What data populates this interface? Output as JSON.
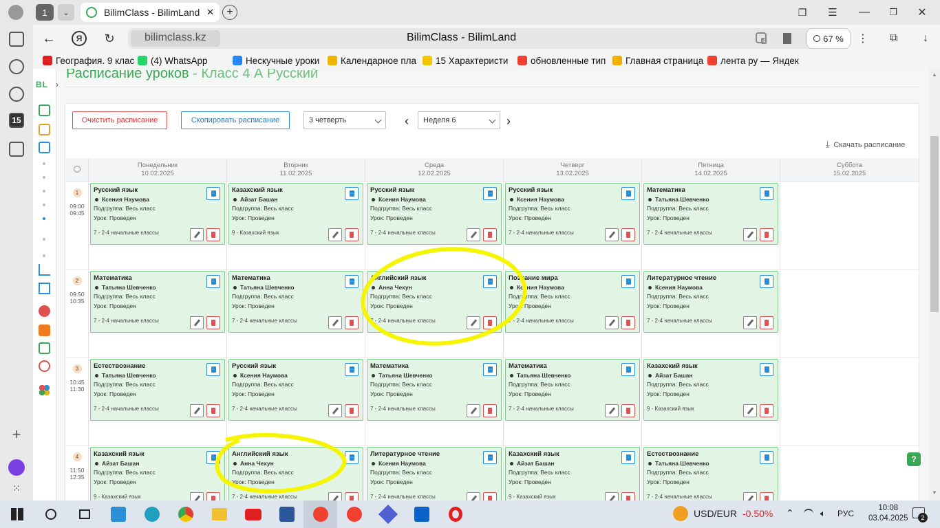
{
  "browser": {
    "tab_count": "1",
    "tab_title": "BilimClass - BilimLand",
    "url": "bilimclass.kz",
    "page_title": "BilimClass - BilimLand",
    "zoom": "67 %",
    "tracker_count": "4"
  },
  "bookmarks": [
    {
      "label": "География. 9 клас",
      "icon": "youtube-icon",
      "color": "#e02020"
    },
    {
      "label": "(4) WhatsApp",
      "icon": "whatsapp-icon",
      "color": "#25d366"
    },
    {
      "label": "Нескучные уроки",
      "icon": "vk-icon",
      "color": "#2787f5"
    },
    {
      "label": "Календарное пла",
      "icon": "doc-icon",
      "color": "#f0b400"
    },
    {
      "label": "15 Характеристи",
      "icon": "play-icon",
      "color": "#f5c400"
    },
    {
      "label": "обновленные тип",
      "icon": "yandex-icon",
      "color": "#f04030"
    },
    {
      "label": "Главная страница",
      "icon": "person-icon",
      "color": "#f0b000"
    },
    {
      "label": "лента ру — Яндек",
      "icon": "yandex-icon",
      "color": "#f04030"
    }
  ],
  "left_rail": {
    "calendar_day": "15"
  },
  "app": {
    "logo": "BL",
    "heading_main": "Расписание уроков",
    "heading_sep": " - ",
    "heading_class": "Класс 4 А Русский",
    "clear_button": "Очистить расписание",
    "copy_button": "Скопировать расписание",
    "quarter_select": "3 четверть",
    "week_select": "Неделя 6",
    "download_link": "Скачать расписание"
  },
  "days": [
    {
      "name": "Понедельник",
      "date": "10.02.2025"
    },
    {
      "name": "Вторник",
      "date": "11.02.2025"
    },
    {
      "name": "Среда",
      "date": "12.02.2025"
    },
    {
      "name": "Четверг",
      "date": "13.02.2025"
    },
    {
      "name": "Пятница",
      "date": "14.02.2025"
    },
    {
      "name": "Суббота",
      "date": "15.02.2025"
    }
  ],
  "periods": [
    {
      "num": "1",
      "start": "09:00",
      "end": "09:45"
    },
    {
      "num": "2",
      "start": "09:50",
      "end": "10:35"
    },
    {
      "num": "3",
      "start": "10:45",
      "end": "11:30"
    },
    {
      "num": "4",
      "start": "11:50",
      "end": "12:35"
    }
  ],
  "labels": {
    "subgroup": "Подгруппа:",
    "subgroup_val": "Весь класс",
    "lesson": "Урок:",
    "lesson_val": "Проведен"
  },
  "lessons": [
    [
      {
        "subject": "Русский язык",
        "teacher": "Ксения Наумова",
        "group": "7 - 2-4 начальные классы"
      },
      {
        "subject": "Математика",
        "teacher": "Татьяна Шевченко",
        "group": "7 - 2-4 начальные классы"
      },
      {
        "subject": "Естествознание",
        "teacher": "Татьяна Шевченко",
        "group": "7 - 2-4 начальные классы"
      },
      {
        "subject": "Казахский язык",
        "teacher": "Айзат Башан",
        "group": "9 - Казахский язык"
      }
    ],
    [
      {
        "subject": "Казахский язык",
        "teacher": "Айзат Башан",
        "group": "9 - Казахский язык"
      },
      {
        "subject": "Математика",
        "teacher": "Татьяна Шевченко",
        "group": "7 - 2-4 начальные классы"
      },
      {
        "subject": "Русский язык",
        "teacher": "Ксения Наумова",
        "group": "7 - 2-4 начальные классы"
      },
      {
        "subject": "Английский язык",
        "teacher": "Анна Чехун",
        "group": "7 - 2-4 начальные классы"
      }
    ],
    [
      {
        "subject": "Русский язык",
        "teacher": "Ксения Наумова",
        "group": "7 - 2-4 начальные классы"
      },
      {
        "subject": "Английский язык",
        "teacher": "Анна Чехун",
        "group": "7 - 2-4 начальные классы"
      },
      {
        "subject": "Математика",
        "teacher": "Татьяна Шевченко",
        "group": "7 - 2-4 начальные классы"
      },
      {
        "subject": "Литературное чтение",
        "teacher": "Ксения Наумова",
        "group": "7 - 2-4 начальные классы"
      }
    ],
    [
      {
        "subject": "Русский язык",
        "teacher": "Ксения Наумова",
        "group": "7 - 2-4 начальные классы"
      },
      {
        "subject": "Познание мира",
        "teacher": "Ксения Наумова",
        "group": "7 - 2-4 начальные классы"
      },
      {
        "subject": "Математика",
        "teacher": "Татьяна Шевченко",
        "group": "7 - 2-4 начальные классы"
      },
      {
        "subject": "Казахский язык",
        "teacher": "Айзат Башан",
        "group": "9 - Казахский язык"
      }
    ],
    [
      {
        "subject": "Математика",
        "teacher": "Татьяна Шевченко",
        "group": "7 - 2-4 начальные классы"
      },
      {
        "subject": "Литературное чтение",
        "teacher": "Ксения Наумова",
        "group": "7 - 2-4 начальные классы"
      },
      {
        "subject": "Казахский язык",
        "teacher": "Айзат Башан",
        "group": "9 - Казахский язык"
      },
      {
        "subject": "Естествознание",
        "teacher": "Татьяна Шевченко",
        "group": "7 - 2-4 начальные классы"
      }
    ]
  ],
  "taskbar": {
    "currency": "USD/EUR",
    "currency_change": "-0.50%",
    "lang": "РУС",
    "time": "10:08",
    "date": "03.04.2025",
    "notifications": "2"
  },
  "colors": {
    "accent_green": "#3aa757",
    "highlight_yellow": "#f5f500"
  }
}
